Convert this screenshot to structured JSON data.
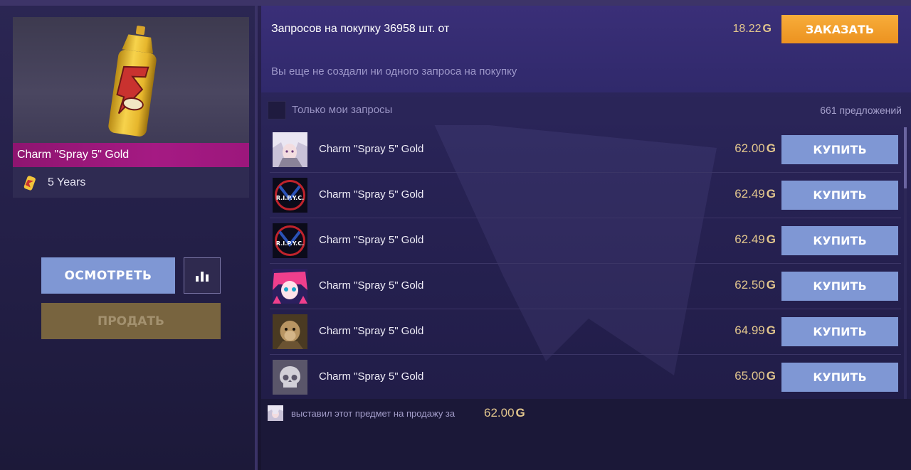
{
  "item": {
    "name": "Charm \"Spray 5\" Gold",
    "collection": "5 Years",
    "image_icon": "gold-spray-can-icon"
  },
  "actions": {
    "inspect_label": "ОСМОТРЕТЬ",
    "stats_icon": "bar-chart-icon",
    "sell_label": "ПРОДАТЬ"
  },
  "requests": {
    "label": "Запросов на покупку 36958 шт. от",
    "price": "18.22",
    "order_label": "ЗАКАЗАТЬ",
    "empty_message": "Вы еще не создали ни одного запроса на покупку"
  },
  "filter": {
    "only_mine_label": "Только мои запросы",
    "only_mine_checked": false,
    "offers_count": "661 предложений"
  },
  "currency_symbol": "G",
  "offers": [
    {
      "name": "Charm \"Spray 5\" Gold",
      "price": "62.00",
      "buy_label": "КУПИТЬ",
      "avatar": "anime-girl-white-hair-avatar"
    },
    {
      "name": "Charm \"Spray 5\" Gold",
      "price": "62.49",
      "buy_label": "КУПИТЬ",
      "avatar": "rip-clan-logo-avatar"
    },
    {
      "name": "Charm \"Spray 5\" Gold",
      "price": "62.49",
      "buy_label": "КУПИТЬ",
      "avatar": "rip-clan-logo-avatar"
    },
    {
      "name": "Charm \"Spray 5\" Gold",
      "price": "62.50",
      "buy_label": "КУПИТЬ",
      "avatar": "anime-girl-pink-hair-avatar"
    },
    {
      "name": "Charm \"Spray 5\" Gold",
      "price": "64.99",
      "buy_label": "КУПИТЬ",
      "avatar": "monkey-photo-avatar"
    },
    {
      "name": "Charm \"Spray 5\" Gold",
      "price": "65.00",
      "buy_label": "КУПИТЬ",
      "avatar": "skull-default-avatar"
    }
  ],
  "avatar_labels": {
    "rip": "R.I.P.Y.C."
  },
  "last_sale": {
    "text": "выставил этот предмет на продажу за",
    "price": "62.00"
  },
  "colors": {
    "accent_blue": "#7f97d4",
    "accent_orange": "#f0a02a",
    "gold_price": "#e2c68d",
    "rarity_bar": "#a01a80"
  }
}
